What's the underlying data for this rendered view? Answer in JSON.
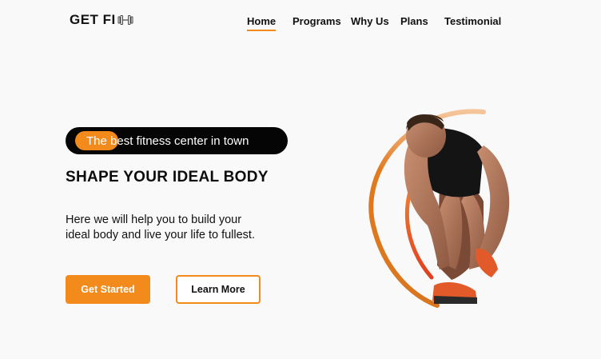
{
  "brand": {
    "name": "GET FI",
    "icon": "dumbbell-icon"
  },
  "nav": {
    "items": [
      {
        "label": "Home",
        "active": true
      },
      {
        "label": "Programs",
        "active": false
      },
      {
        "label": "Why Us",
        "active": false
      },
      {
        "label": "Plans",
        "active": false
      },
      {
        "label": "Testimonial",
        "active": false
      }
    ]
  },
  "hero": {
    "tagline": "The best fitness center in town",
    "title": "SHAPE YOUR IDEAL BODY",
    "description": "Here we will help you to build your ideal body and live your life to fullest.",
    "primary_button": "Get Started",
    "secondary_button": "Learn More",
    "image": "athlete-tying-shoe-image"
  },
  "colors": {
    "accent": "#f28a1c",
    "dark": "#050505",
    "background": "#f9f9fa"
  }
}
